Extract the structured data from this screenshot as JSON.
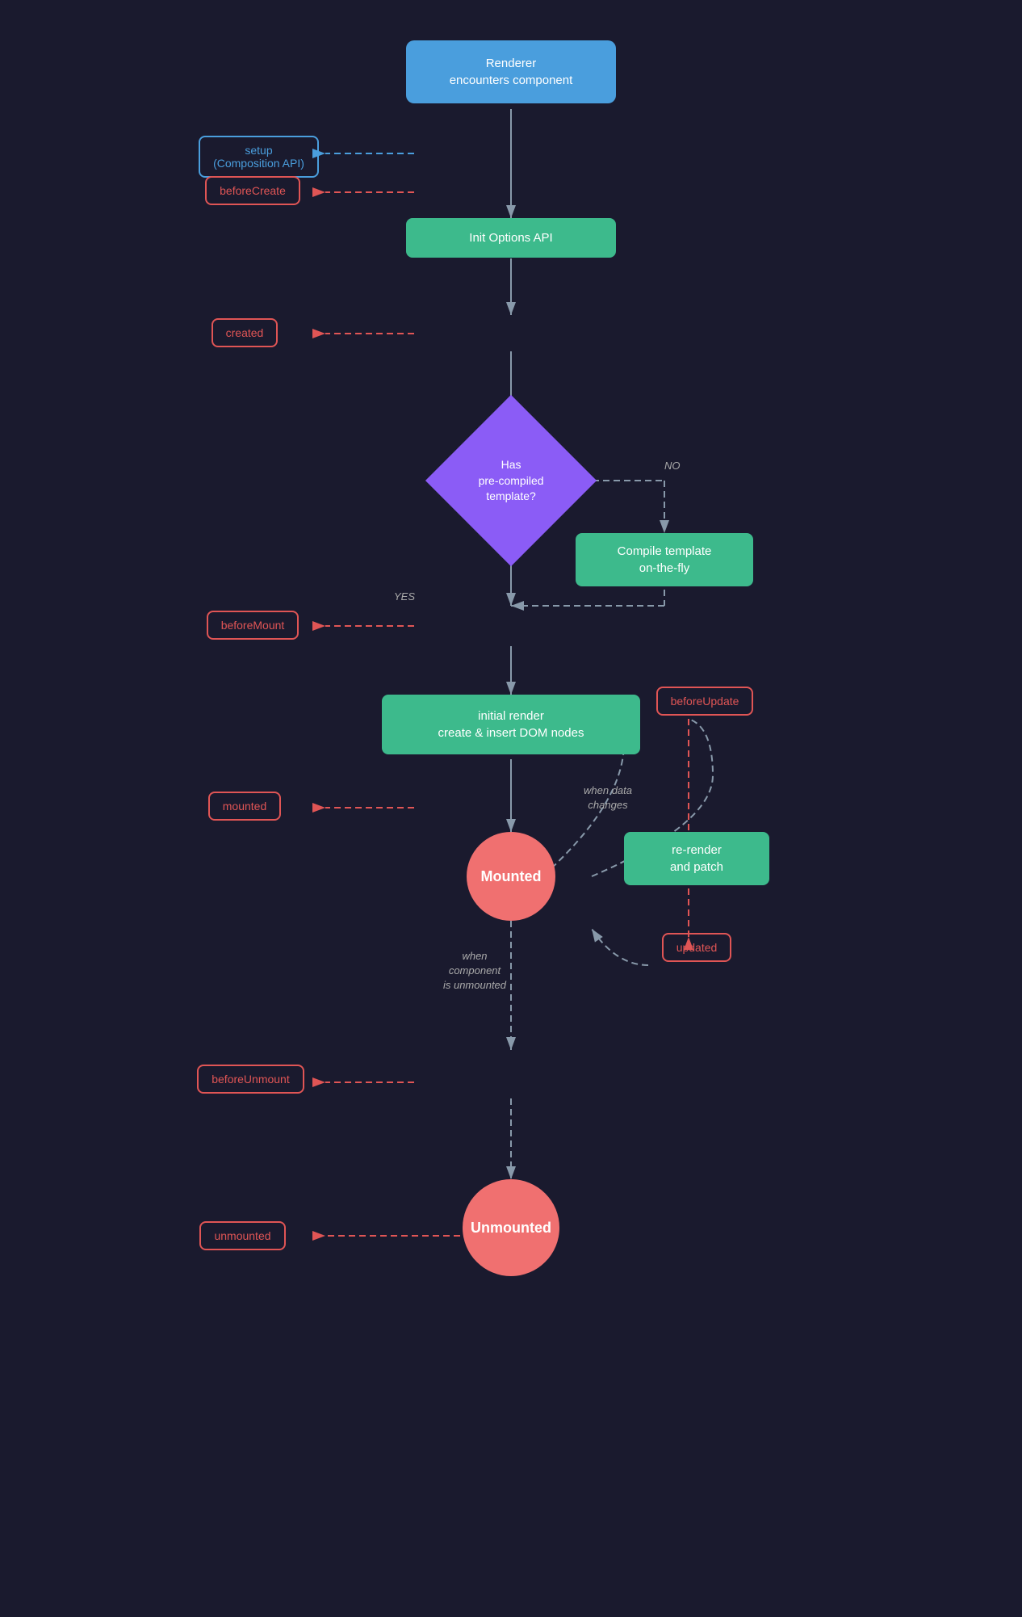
{
  "nodes": {
    "renderer": {
      "label": "Renderer\nencounters component",
      "type": "blue-rect"
    },
    "setup": {
      "label": "setup\n(Composition API)",
      "type": "hook-blue"
    },
    "beforeCreate": {
      "label": "beforeCreate",
      "type": "hook-red"
    },
    "initOptions": {
      "label": "Init Options API",
      "type": "green-rect"
    },
    "created": {
      "label": "created",
      "type": "hook-red"
    },
    "hasTemplate": {
      "label": "Has\npre-compiled\ntemplate?",
      "type": "diamond"
    },
    "compileTemplate": {
      "label": "Compile template\non-the-fly",
      "type": "green-rect"
    },
    "beforeMount": {
      "label": "beforeMount",
      "type": "hook-red"
    },
    "initialRender": {
      "label": "initial render\ncreate & insert DOM nodes",
      "type": "green-rect"
    },
    "mounted": {
      "label": "mounted",
      "type": "hook-red"
    },
    "mountedCircle": {
      "label": "Mounted",
      "type": "circle"
    },
    "beforeUpdate": {
      "label": "beforeUpdate",
      "type": "hook-red"
    },
    "reRender": {
      "label": "re-render\nand patch",
      "type": "green-rect"
    },
    "updated": {
      "label": "updated",
      "type": "hook-red"
    },
    "beforeUnmount": {
      "label": "beforeUnmount",
      "type": "hook-red"
    },
    "unmountedCircle": {
      "label": "Unmounted",
      "type": "circle"
    },
    "unmounted": {
      "label": "unmounted",
      "type": "hook-red"
    }
  },
  "labels": {
    "no": "NO",
    "yes": "YES",
    "whenDataChanges": "when data\nchanges",
    "whenComponentUnmounted": "when\ncomponent\nis unmounted"
  },
  "colors": {
    "blue": "#4a9edd",
    "green": "#3dba8c",
    "purple": "#8b5cf6",
    "red-hook": "#e05555",
    "circle-red": "#f07070",
    "arrow-solid": "#8899aa",
    "arrow-dashed": "#8899aa"
  }
}
